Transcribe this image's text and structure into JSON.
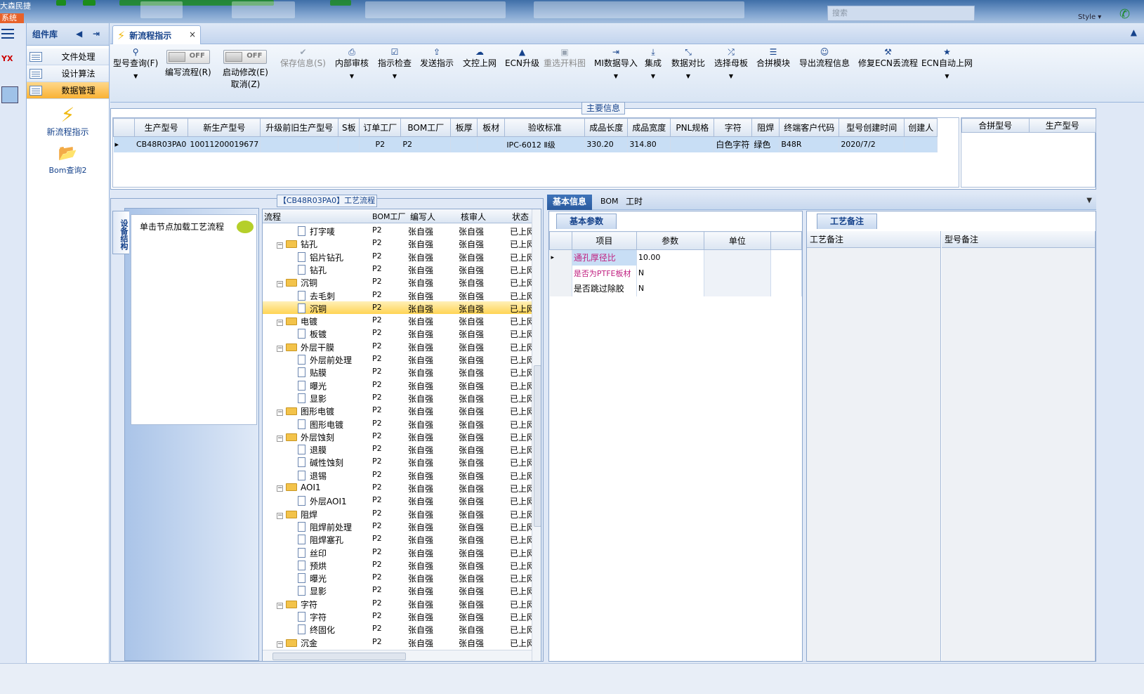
{
  "topbar": {
    "system_title": "大森民捷",
    "system_label": "系统",
    "search_placeholder": "搜索",
    "style_label": "Style ▾"
  },
  "component_panel": {
    "title": "组件库",
    "items": [
      {
        "label": "文件处理",
        "active": false
      },
      {
        "label": "设计算法",
        "active": false
      },
      {
        "label": "数据管理",
        "active": true
      }
    ],
    "sub_items": [
      {
        "label": "新流程指示",
        "icon": "lightning-icon"
      },
      {
        "label": "Bom查询2",
        "icon": "folder-icon"
      }
    ]
  },
  "tabs": [
    {
      "label": "新流程指示",
      "closable": true
    }
  ],
  "toolbar": {
    "buttons": [
      {
        "label": "型号查询(F)",
        "icon": "search-icon",
        "dropdown": true,
        "disabled": false
      },
      {
        "label": "编写流程(R)",
        "toggle": "OFF",
        "disabled": false
      },
      {
        "label": "启动修改(E)",
        "label2": "取消(Z)",
        "toggle": "OFF",
        "disabled": false
      },
      {
        "label": "保存信息(S)",
        "icon": "check-icon",
        "disabled": true
      },
      {
        "label": "内部审核",
        "icon": "printer-icon",
        "dropdown": true,
        "disabled": false
      },
      {
        "label": "指示检查",
        "icon": "checkbox-icon",
        "dropdown": true,
        "disabled": false
      },
      {
        "label": "发送指示",
        "icon": "upload-icon",
        "disabled": false
      },
      {
        "label": "文控上网",
        "icon": "cloud-upload-icon",
        "disabled": false
      },
      {
        "label": "ECN升级",
        "icon": "ecn-icon",
        "disabled": false
      },
      {
        "label": "重选开料图",
        "icon": "image-icon",
        "disabled": true
      },
      {
        "label": "MI数据导入",
        "icon": "import-icon",
        "dropdown": true,
        "disabled": false
      },
      {
        "label": "集成",
        "icon": "download-icon",
        "dropdown": true,
        "disabled": false
      },
      {
        "label": "数据对比",
        "icon": "compare-icon",
        "dropdown": true,
        "disabled": false
      },
      {
        "label": "选择母板",
        "icon": "shuffle-icon",
        "dropdown": true,
        "disabled": false
      },
      {
        "label": "合拼模块",
        "icon": "list-icon",
        "disabled": false
      },
      {
        "label": "导出流程信息",
        "icon": "smile-icon",
        "disabled": false
      },
      {
        "label": "修复ECN丢流程",
        "icon": "wrench-icon",
        "disabled": false
      },
      {
        "label": "ECN自动上网",
        "icon": "star-icon",
        "dropdown": true,
        "disabled": false
      }
    ]
  },
  "main_info": {
    "caption": "主要信息",
    "columns": [
      "生产型号",
      "新生产型号",
      "升级前旧生产型号",
      "S板",
      "订单工厂",
      "BOM工厂",
      "板厚",
      "板材",
      "验收标准",
      "成品长度",
      "成品宽度",
      "PNL规格",
      "字符",
      "阻焊",
      "终端客户代码",
      "型号创建时间",
      "创建人"
    ],
    "rows": [
      [
        "CB48R03PA0",
        "10011200019677",
        "",
        "",
        "P2",
        "P2",
        "",
        "",
        "IPC-6012 Ⅱ级",
        "330.20",
        "314.80",
        "",
        "白色字符",
        "绿色",
        "B48R",
        "2020/7/2",
        ""
      ]
    ],
    "side_columns": [
      "合拼型号",
      "生产型号"
    ]
  },
  "flow": {
    "caption": "【CB48R03PA0】工艺流程",
    "vertical_tab": "设备结构",
    "hint": "单击节点加载工艺流程",
    "columns": [
      "流程",
      "BOM工厂",
      "编写人",
      "核审人",
      "状态"
    ],
    "rows": [
      {
        "name": "打字唛",
        "level": 1,
        "bom": "P2",
        "writer": "张自强",
        "reviewer": "张自强",
        "status": "已上网"
      },
      {
        "name": "钻孔",
        "level": 0,
        "bom": "P2",
        "writer": "张自强",
        "reviewer": "张自强",
        "status": "已上网"
      },
      {
        "name": "铝片钻孔",
        "level": 1,
        "bom": "P2",
        "writer": "张自强",
        "reviewer": "张自强",
        "status": "已上网"
      },
      {
        "name": "钻孔",
        "level": 1,
        "bom": "P2",
        "writer": "张自强",
        "reviewer": "张自强",
        "status": "已上网"
      },
      {
        "name": "沉铜",
        "level": 0,
        "bom": "P2",
        "writer": "张自强",
        "reviewer": "张自强",
        "status": "已上网"
      },
      {
        "name": "去毛刺",
        "level": 1,
        "bom": "P2",
        "writer": "张自强",
        "reviewer": "张自强",
        "status": "已上网"
      },
      {
        "name": "沉铜",
        "level": 1,
        "bom": "P2",
        "writer": "张自强",
        "reviewer": "张自强",
        "status": "已上网",
        "selected": true
      },
      {
        "name": "电镀",
        "level": 0,
        "bom": "P2",
        "writer": "张自强",
        "reviewer": "张自强",
        "status": "已上网"
      },
      {
        "name": "板镀",
        "level": 1,
        "bom": "P2",
        "writer": "张自强",
        "reviewer": "张自强",
        "status": "已上网"
      },
      {
        "name": "外层干膜",
        "level": 0,
        "bom": "P2",
        "writer": "张自强",
        "reviewer": "张自强",
        "status": "已上网"
      },
      {
        "name": "外层前处理",
        "level": 1,
        "bom": "P2",
        "writer": "张自强",
        "reviewer": "张自强",
        "status": "已上网"
      },
      {
        "name": "贴膜",
        "level": 1,
        "bom": "P2",
        "writer": "张自强",
        "reviewer": "张自强",
        "status": "已上网"
      },
      {
        "name": "曝光",
        "level": 1,
        "bom": "P2",
        "writer": "张自强",
        "reviewer": "张自强",
        "status": "已上网"
      },
      {
        "name": "显影",
        "level": 1,
        "bom": "P2",
        "writer": "张自强",
        "reviewer": "张自强",
        "status": "已上网"
      },
      {
        "name": "图形电镀",
        "level": 0,
        "bom": "P2",
        "writer": "张自强",
        "reviewer": "张自强",
        "status": "已上网"
      },
      {
        "name": "图形电镀",
        "level": 1,
        "bom": "P2",
        "writer": "张自强",
        "reviewer": "张自强",
        "status": "已上网"
      },
      {
        "name": "外层蚀刻",
        "level": 0,
        "bom": "P2",
        "writer": "张自强",
        "reviewer": "张自强",
        "status": "已上网"
      },
      {
        "name": "退膜",
        "level": 1,
        "bom": "P2",
        "writer": "张自强",
        "reviewer": "张自强",
        "status": "已上网"
      },
      {
        "name": "碱性蚀刻",
        "level": 1,
        "bom": "P2",
        "writer": "张自强",
        "reviewer": "张自强",
        "status": "已上网"
      },
      {
        "name": "退锡",
        "level": 1,
        "bom": "P2",
        "writer": "张自强",
        "reviewer": "张自强",
        "status": "已上网"
      },
      {
        "name": "AOI1",
        "level": 0,
        "bom": "P2",
        "writer": "张自强",
        "reviewer": "张自强",
        "status": "已上网"
      },
      {
        "name": "外层AOI1",
        "level": 1,
        "bom": "P2",
        "writer": "张自强",
        "reviewer": "张自强",
        "status": "已上网"
      },
      {
        "name": "阻焊",
        "level": 0,
        "bom": "P2",
        "writer": "张自强",
        "reviewer": "张自强",
        "status": "已上网"
      },
      {
        "name": "阻焊前处理",
        "level": 1,
        "bom": "P2",
        "writer": "张自强",
        "reviewer": "张自强",
        "status": "已上网"
      },
      {
        "name": "阻焊塞孔",
        "level": 1,
        "bom": "P2",
        "writer": "张自强",
        "reviewer": "张自强",
        "status": "已上网"
      },
      {
        "name": "丝印",
        "level": 1,
        "bom": "P2",
        "writer": "张自强",
        "reviewer": "张自强",
        "status": "已上网"
      },
      {
        "name": "预烘",
        "level": 1,
        "bom": "P2",
        "writer": "张自强",
        "reviewer": "张自强",
        "status": "已上网"
      },
      {
        "name": "曝光",
        "level": 1,
        "bom": "P2",
        "writer": "张自强",
        "reviewer": "张自强",
        "status": "已上网"
      },
      {
        "name": "显影",
        "level": 1,
        "bom": "P2",
        "writer": "张自强",
        "reviewer": "张自强",
        "status": "已上网"
      },
      {
        "name": "字符",
        "level": 0,
        "bom": "P2",
        "writer": "张自强",
        "reviewer": "张自强",
        "status": "已上网"
      },
      {
        "name": "字符",
        "level": 1,
        "bom": "P2",
        "writer": "张自强",
        "reviewer": "张自强",
        "status": "已上网"
      },
      {
        "name": "终固化",
        "level": 1,
        "bom": "P2",
        "writer": "张自强",
        "reviewer": "张自强",
        "status": "已上网"
      },
      {
        "name": "沉金",
        "level": 0,
        "bom": "P2",
        "writer": "张自强",
        "reviewer": "张自强",
        "status": "已上网"
      }
    ]
  },
  "right_tabs": [
    {
      "label": "基本信息",
      "active": true
    },
    {
      "label": "BOM",
      "active": false
    },
    {
      "label": "工时",
      "active": false
    }
  ],
  "basic_params": {
    "group_label": "基本参数",
    "columns": [
      "项目",
      "参数",
      "单位"
    ],
    "rows": [
      {
        "item": "通孔厚径比",
        "value": "10.00",
        "unit": "",
        "item_color": "#c02080"
      },
      {
        "item": "是否为PTFE板材",
        "value": "N",
        "unit": "",
        "item_color": "#c02080"
      },
      {
        "item": "是否跳过除胶",
        "value": "N",
        "unit": "",
        "item_color": "#000000"
      }
    ]
  },
  "notes": {
    "group_label": "工艺备注",
    "columns": [
      "工艺备注",
      "型号备注"
    ]
  }
}
